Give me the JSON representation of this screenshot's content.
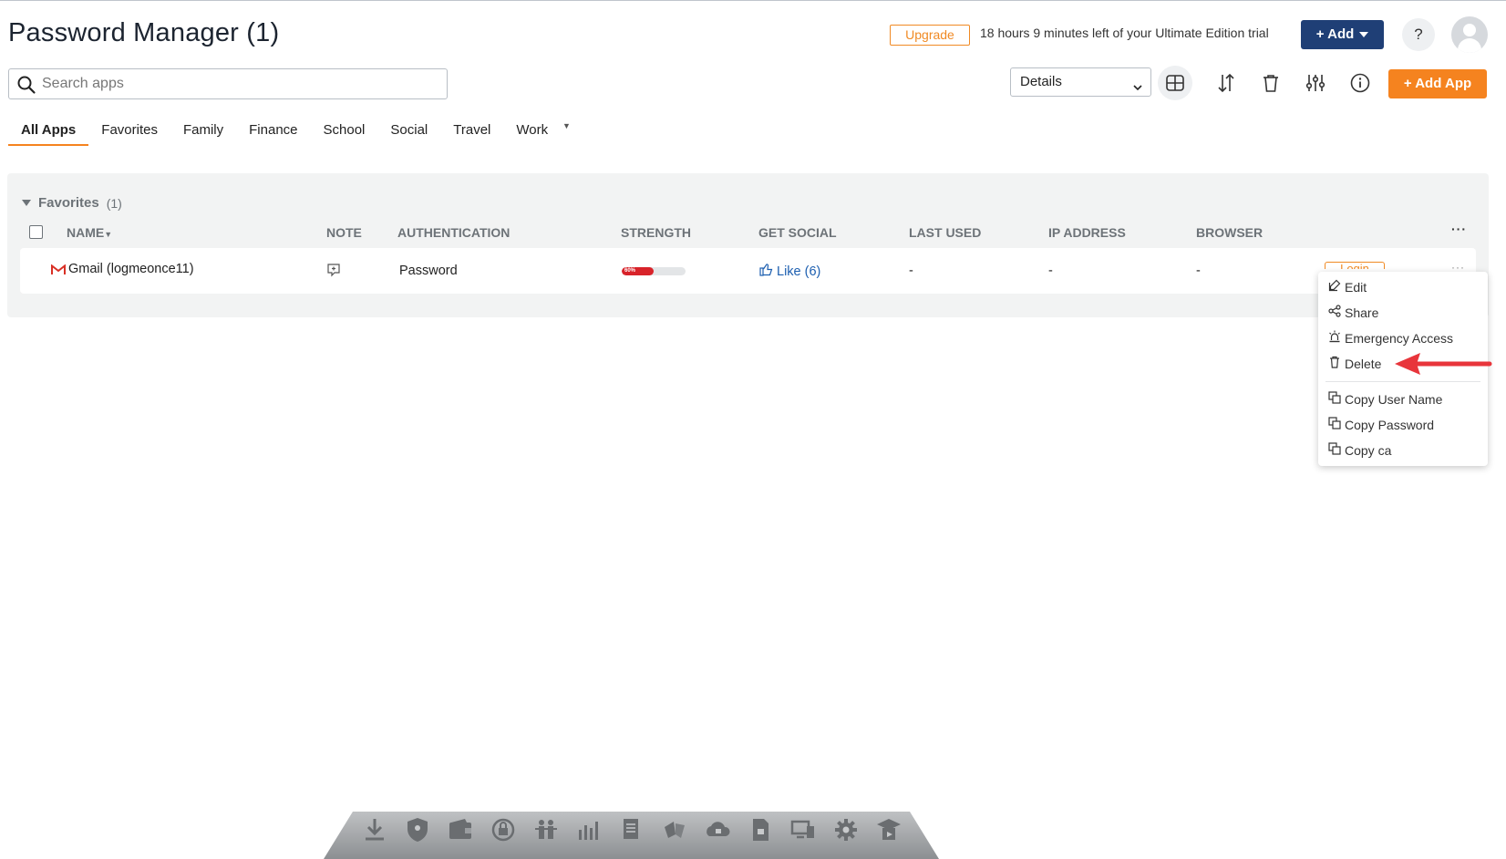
{
  "header": {
    "title": "Password Manager (1)",
    "upgrade_label": "Upgrade",
    "trial_text": "18 hours 9 minutes left of your Ultimate Edition trial",
    "add_label": "+ Add",
    "help_label": "?"
  },
  "toolbar": {
    "search_placeholder": "Search apps",
    "search_value": "",
    "view_selected": "Details",
    "add_app_label": "+ Add App",
    "icons": [
      "grid-view-icon",
      "sort-icon",
      "trash-icon",
      "filter-sliders-icon",
      "info-icon"
    ]
  },
  "tabs": [
    {
      "label": "All Apps",
      "active": true
    },
    {
      "label": "Favorites"
    },
    {
      "label": "Family"
    },
    {
      "label": "Finance"
    },
    {
      "label": "School"
    },
    {
      "label": "Social"
    },
    {
      "label": "Travel"
    },
    {
      "label": "Work"
    }
  ],
  "group": {
    "name": "Favorites",
    "count": "(1)"
  },
  "table": {
    "columns": [
      "NAME",
      "NOTE",
      "AUTHENTICATION",
      "STRENGTH",
      "GET SOCIAL",
      "LAST USED",
      "IP ADDRESS",
      "BROWSER"
    ],
    "more_label": "···",
    "rows": [
      {
        "name": "Gmail (logmeonce11)",
        "authentication": "Password",
        "strength_label": "60%",
        "strength_value": 0.5,
        "social": "Like (6)",
        "last_used": "-",
        "ip_address": "-",
        "browser": "-",
        "login_label": "Login"
      }
    ]
  },
  "context_menu": {
    "items": [
      {
        "label": "Edit",
        "icon": "edit-icon"
      },
      {
        "label": "Share",
        "icon": "share-icon"
      },
      {
        "label": "Emergency Access",
        "icon": "emergency-icon"
      },
      {
        "label": "Delete",
        "icon": "trash-icon"
      },
      {
        "label": "Copy User Name",
        "icon": "copy-icon"
      },
      {
        "label": "Copy Password",
        "icon": "copy-icon"
      },
      {
        "label": "Copy ca",
        "icon": "copy-icon"
      }
    ]
  },
  "colors": {
    "brand_orange": "#f5831f",
    "brand_navy": "#1f3f76",
    "strength_red": "#d8232a",
    "link_blue": "#1d5fb0",
    "annotation_red": "#e8353b"
  }
}
